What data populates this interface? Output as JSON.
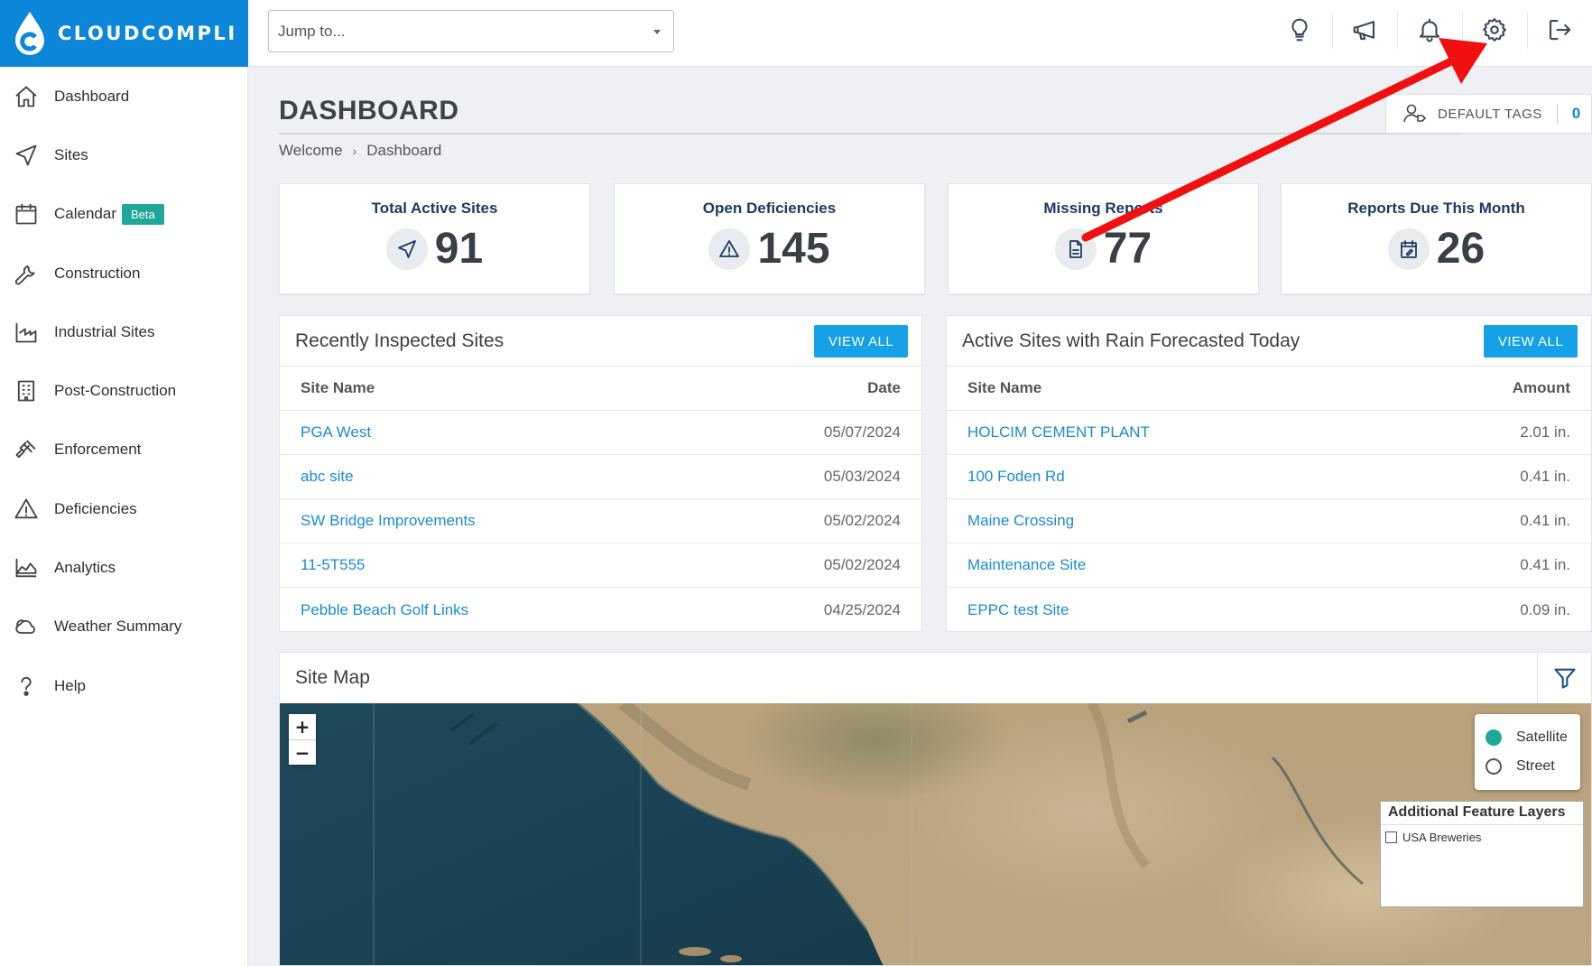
{
  "app": {
    "brand": "CLOUDCOMPLI"
  },
  "search": {
    "placeholder": "Jump to..."
  },
  "sidebar": {
    "items": [
      {
        "label": "Dashboard"
      },
      {
        "label": "Sites"
      },
      {
        "label": "Calendar",
        "badge": "Beta"
      },
      {
        "label": "Construction"
      },
      {
        "label": "Industrial Sites"
      },
      {
        "label": "Post-Construction"
      },
      {
        "label": "Enforcement"
      },
      {
        "label": "Deficiencies"
      },
      {
        "label": "Analytics"
      },
      {
        "label": "Weather Summary"
      },
      {
        "label": "Help"
      }
    ]
  },
  "topbar": {
    "icons": [
      "lightbulb-icon",
      "megaphone-icon",
      "bell-icon",
      "gear-icon",
      "logout-icon"
    ]
  },
  "page": {
    "title": "DASHBOARD",
    "breadcrumb": [
      "Welcome",
      "Dashboard"
    ],
    "default_tags": {
      "label": "DEFAULT TAGS",
      "count": "0"
    }
  },
  "stats": [
    {
      "label": "Total Active Sites",
      "value": "91",
      "icon": "navigation-arrow-icon"
    },
    {
      "label": "Open Deficiencies",
      "value": "145",
      "icon": "warning-triangle-icon"
    },
    {
      "label": "Missing Reports",
      "value": "77",
      "icon": "document-icon"
    },
    {
      "label": "Reports Due This Month",
      "value": "26",
      "icon": "calendar-edit-icon"
    }
  ],
  "recent_sites": {
    "title": "Recently Inspected Sites",
    "button": "VIEW ALL",
    "columns": [
      "Site Name",
      "Date"
    ],
    "rows": [
      {
        "name": "PGA West",
        "value": "05/07/2024"
      },
      {
        "name": "abc site",
        "value": "05/03/2024"
      },
      {
        "name": "SW Bridge Improvements",
        "value": "05/02/2024"
      },
      {
        "name": "11-5T555",
        "value": "05/02/2024"
      },
      {
        "name": "Pebble Beach Golf Links",
        "value": "04/25/2024"
      }
    ]
  },
  "rain_sites": {
    "title": "Active Sites with Rain Forecasted Today",
    "button": "VIEW ALL",
    "columns": [
      "Site Name",
      "Amount"
    ],
    "rows": [
      {
        "name": "HOLCIM CEMENT PLANT",
        "value": "2.01 in."
      },
      {
        "name": "100 Foden Rd",
        "value": "0.41 in."
      },
      {
        "name": "Maine Crossing",
        "value": "0.41 in."
      },
      {
        "name": "Maintenance Site",
        "value": "0.41 in."
      },
      {
        "name": "EPPC test Site",
        "value": "0.09 in."
      }
    ]
  },
  "site_map": {
    "title": "Site Map",
    "zoom_in": "+",
    "zoom_out": "−",
    "base_layers": [
      {
        "label": "Satellite",
        "selected": true
      },
      {
        "label": "Street",
        "selected": false
      }
    ],
    "feature_layers": {
      "title": "Additional Feature Layers",
      "items": [
        {
          "label": "USA Breweries",
          "checked": false
        }
      ]
    }
  },
  "colors": {
    "brand": "#0b86d9",
    "button": "#15a0e8",
    "beta": "#1fa89a",
    "annotation_arrow": "#f01010"
  }
}
